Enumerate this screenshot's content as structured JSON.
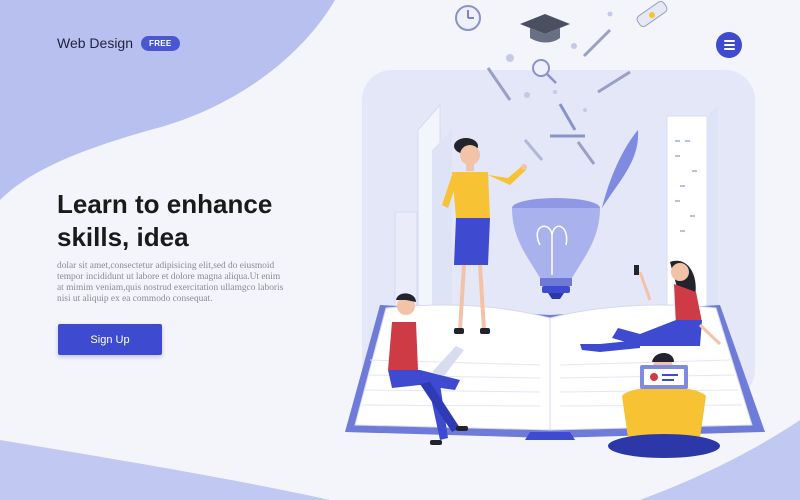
{
  "header": {
    "brand_name": "Web Design",
    "badge": "FREE",
    "menu_icon": "hamburger-menu-icon"
  },
  "hero": {
    "headline": "Learn to enhance skills, idea",
    "body": "dolar sit amet,consectetur adipisicing elit,sed do eiusmoid tempor incididunt ut labore et dolore magna aliqua.Ut enim at mimim veniam,quis nostrud exercitation ullamgco laboris nisi ut aliquip ex ea commodo consequat.",
    "cta_label": "Sign Up"
  },
  "colors": {
    "accent": "#3e4bd0",
    "blob": "#b7c0ef",
    "background": "#f4f5fb",
    "yellow": "#f7c234"
  },
  "illustration": {
    "icons": [
      "alarm-clock-icon",
      "graduation-cap-icon",
      "pen-icon",
      "diploma-icon",
      "magnifier-icon",
      "microscope-icon",
      "lightbulb-icon",
      "open-book-icon"
    ]
  }
}
